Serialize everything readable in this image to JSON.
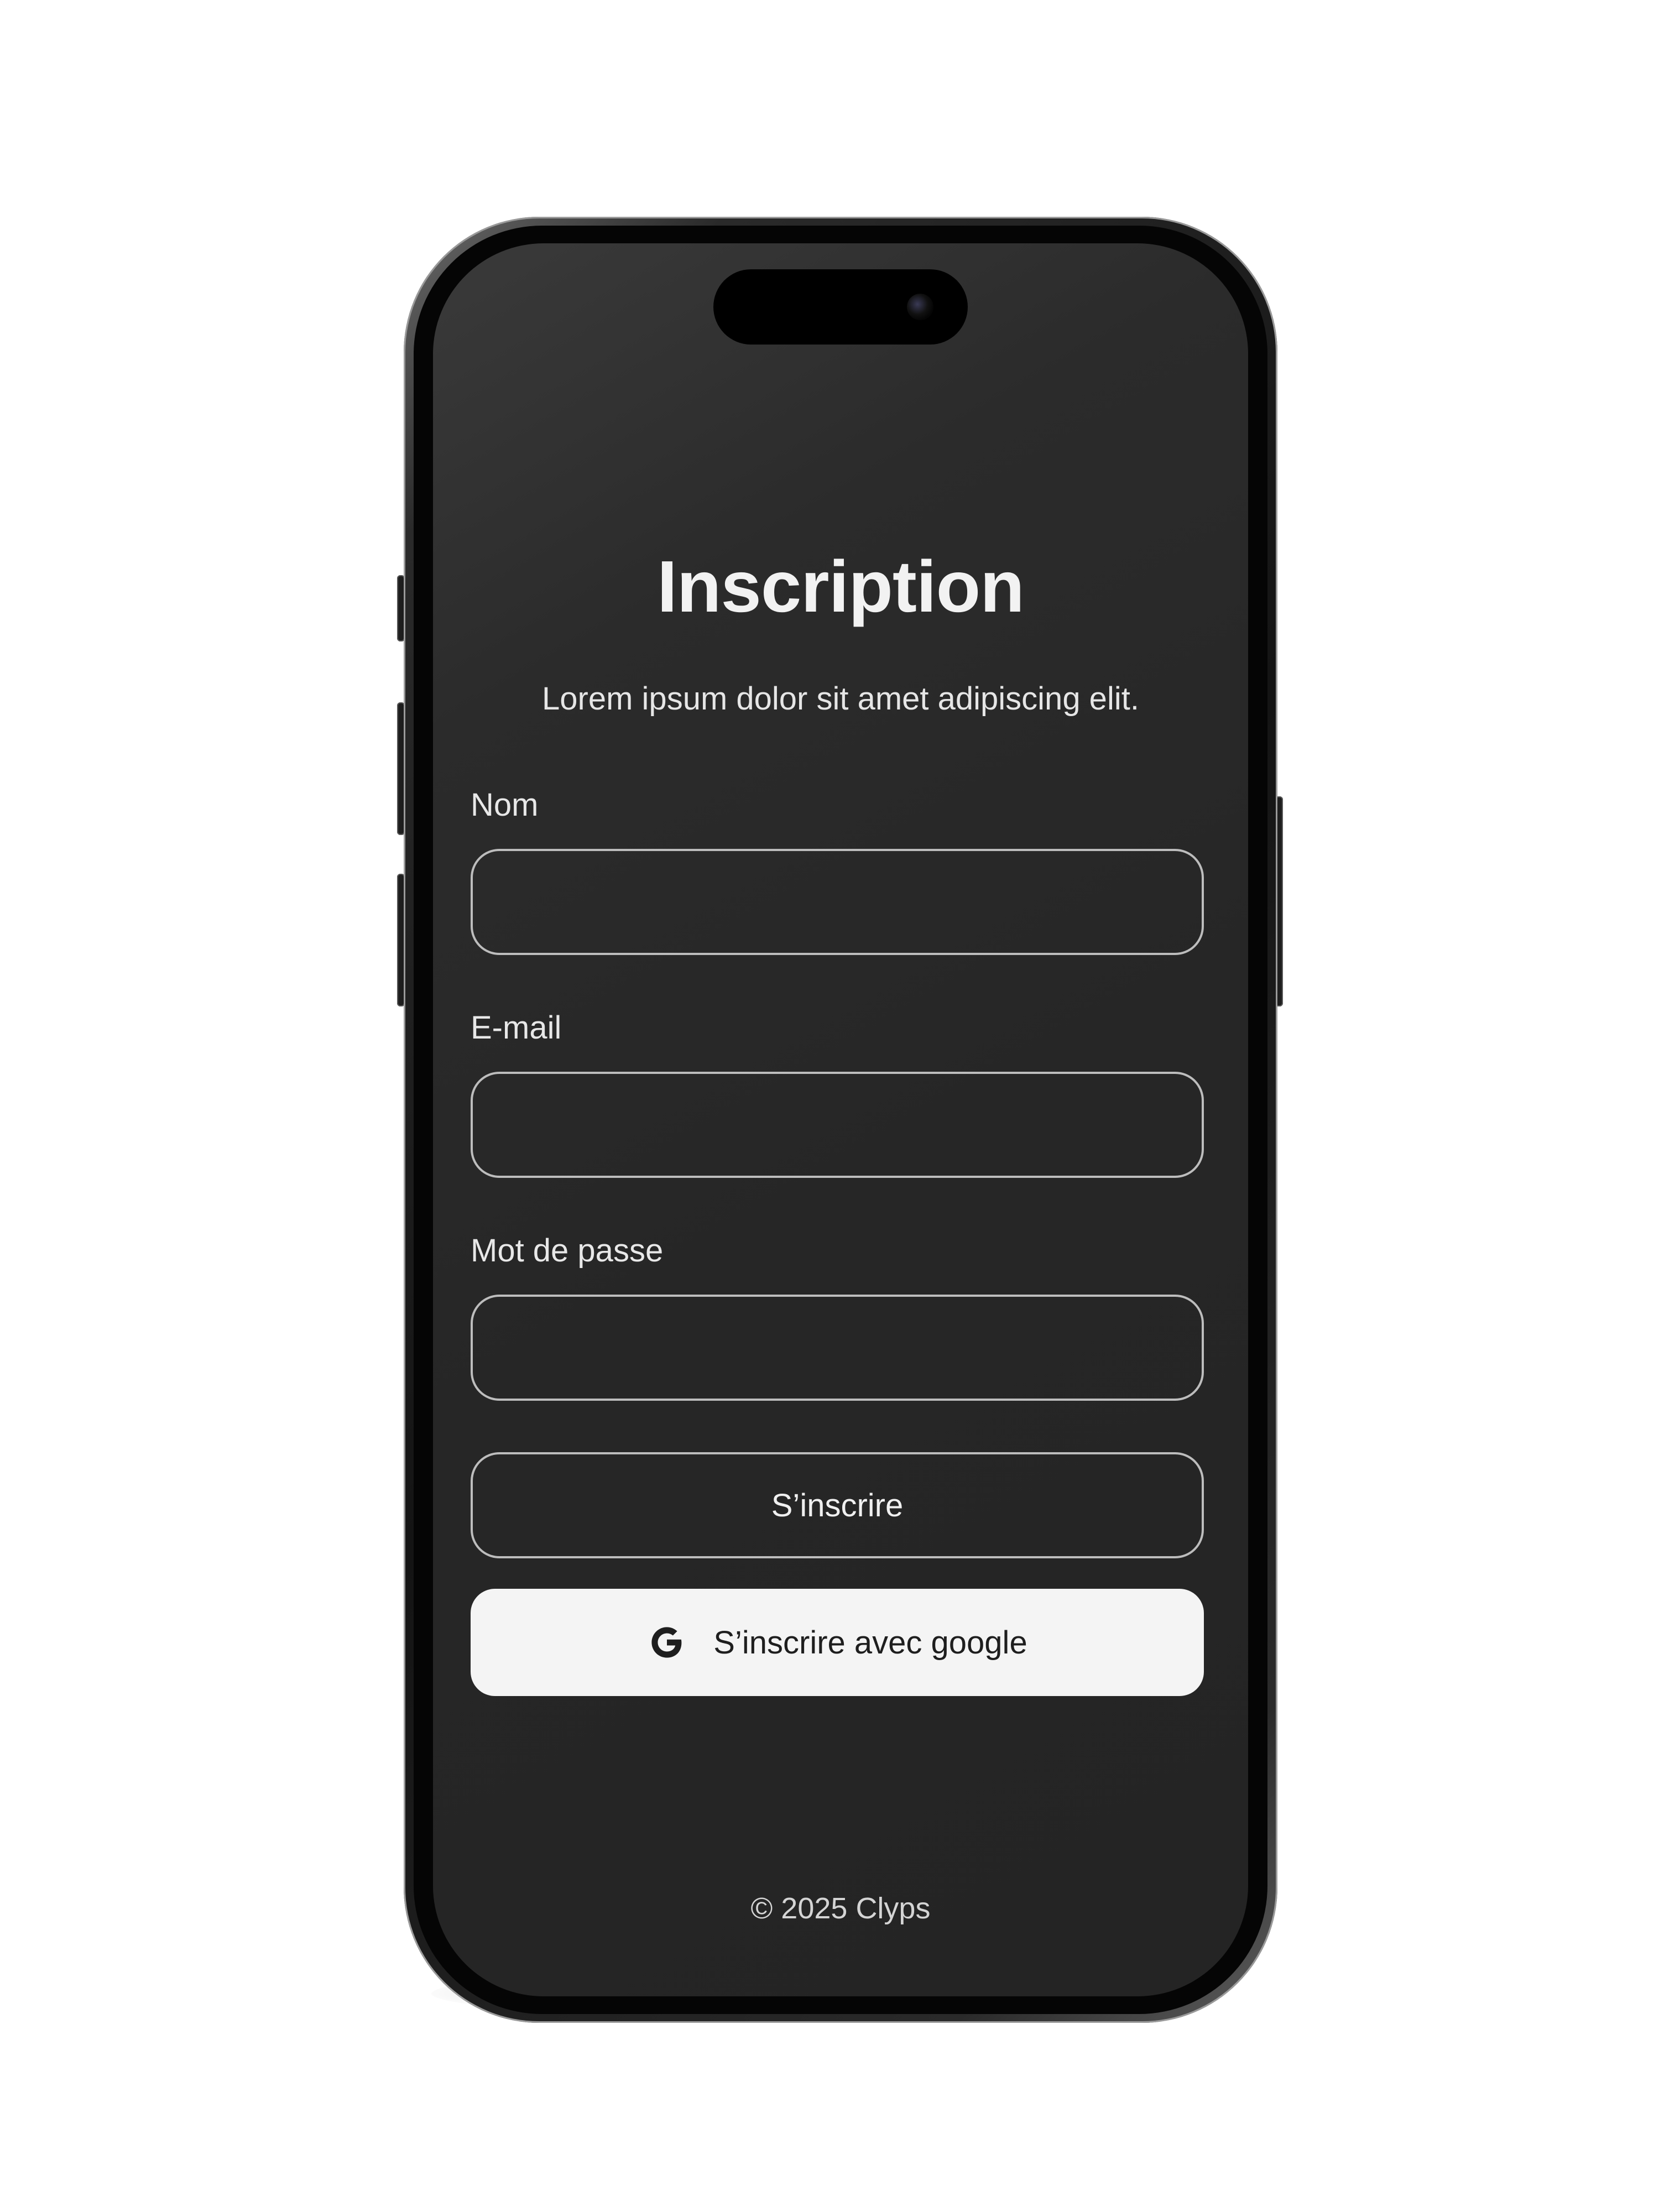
{
  "signup": {
    "title": "Inscription",
    "subtitle": "Lorem ipsum dolor sit amet adipiscing elit.",
    "fields": [
      {
        "label": "Nom",
        "value": "",
        "placeholder": ""
      },
      {
        "label": "E-mail",
        "value": "",
        "placeholder": ""
      },
      {
        "label": "Mot de passe",
        "value": "",
        "placeholder": ""
      }
    ],
    "submit_label": "S’inscrire",
    "google_label": "S’inscrire avec google",
    "google_icon": "google-g-icon",
    "footer": "© 2025 Clyps"
  },
  "colors": {
    "screen_background": "#262626",
    "text": "#f2f2f2",
    "field_border": "#bdbdbd",
    "google_button_background": "#f4f4f4",
    "google_button_text": "#1e1e1e"
  }
}
